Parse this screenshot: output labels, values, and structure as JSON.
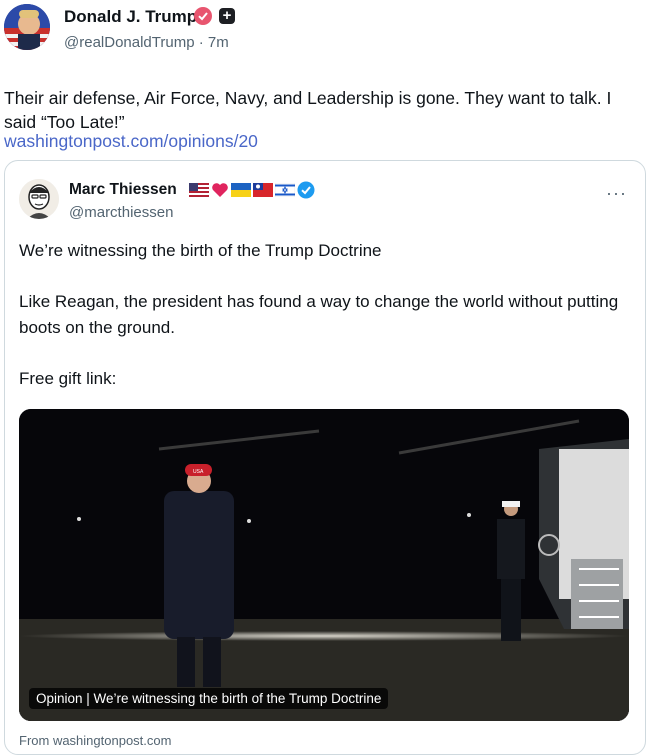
{
  "post": {
    "author": "Donald J. Trump",
    "handle": "@realDonaldTrump",
    "separator": "·",
    "time": "7m",
    "text": "Their air defense, Air Force, Navy, and Leadership is gone. They want to talk. I said “Too Late!”",
    "link": "washingtonpost.com/opinions/20"
  },
  "quote": {
    "author": "Marc Thiessen",
    "handle": "@marcthiessen",
    "more": "···",
    "paragraphs": [
      "We’re witnessing the birth of the Trump Doctrine",
      "Like Reagan, the president has found a way to change the world without putting boots on the ground.",
      "Free gift link:"
    ],
    "media_caption": "Opinion | We’re witnessing the birth of the Trump Doctrine",
    "hat_text": "USA",
    "source": "From washingtonpost.com"
  },
  "colors": {
    "link": "#4a67c8",
    "verified": "#1d9bf0",
    "secondary_text": "#536471"
  },
  "icons": {
    "gold_badge": "verified-badge-icon",
    "plus": "plus-square-icon",
    "verified": "verified-check-icon",
    "more": "more-options-icon"
  }
}
